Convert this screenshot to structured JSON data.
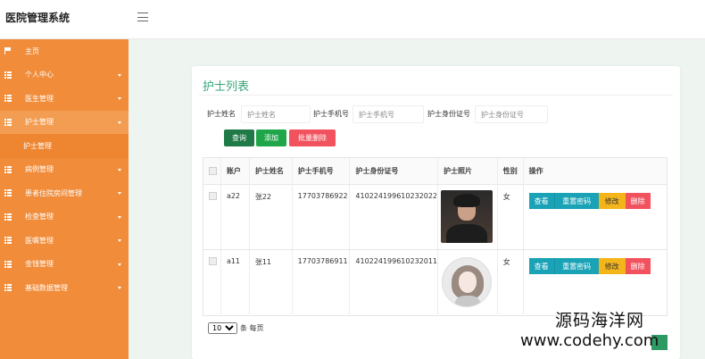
{
  "header": {
    "brand": "医院管理系统"
  },
  "sidebar": {
    "items": [
      {
        "label": "主页",
        "icon": "flag-icon",
        "caret": false
      },
      {
        "label": "个人中心",
        "icon": "list-icon",
        "caret": true
      },
      {
        "label": "医生管理",
        "icon": "list-icon",
        "caret": true
      },
      {
        "label": "护士管理",
        "icon": "list-icon",
        "caret": true,
        "active": true
      },
      {
        "label": "护士管理",
        "icon": "",
        "sub": true
      },
      {
        "label": "病例管理",
        "icon": "list-icon",
        "caret": true
      },
      {
        "label": "患者住院房间管理",
        "icon": "list-icon",
        "caret": true
      },
      {
        "label": "检查管理",
        "icon": "list-icon",
        "caret": true
      },
      {
        "label": "医嘱管理",
        "icon": "list-icon",
        "caret": true
      },
      {
        "label": "金钱管理",
        "icon": "list-icon",
        "caret": true
      },
      {
        "label": "基础数据管理",
        "icon": "list-icon",
        "caret": true
      }
    ]
  },
  "main": {
    "title": "护士列表",
    "search": {
      "name_label": "护士姓名",
      "name_placeholder": "护士姓名",
      "phone_label": "护士手机号",
      "phone_placeholder": "护士手机号",
      "idcard_label": "护士身份证号",
      "idcard_placeholder": "护士身份证号"
    },
    "buttons": {
      "query": "查询",
      "add": "添加",
      "bulk_delete": "批量删除"
    },
    "table": {
      "headers": [
        "账户",
        "护士姓名",
        "护士手机号",
        "护士身份证号",
        "护士照片",
        "性别",
        "操作"
      ],
      "rows": [
        {
          "account": "a22",
          "name": "张22",
          "phone": "17703786922",
          "idcard": "410224199610232022",
          "photo": "male-portrait",
          "sex": "女"
        },
        {
          "account": "a11",
          "name": "张11",
          "phone": "17703786911",
          "idcard": "410224199610232011",
          "photo": "female-illustration",
          "sex": "女"
        }
      ],
      "actions": {
        "view": "查看",
        "reset": "重置密码",
        "edit": "修改",
        "delete": "删除"
      }
    },
    "pager": {
      "page_size": "10",
      "per_page_text": "条 每页"
    }
  },
  "watermark": {
    "line1": "源码海洋网",
    "line2": "www.codehy.com"
  },
  "colors": {
    "sidebar": "#f08c3a",
    "title": "#3aa57a",
    "query": "#1f7a47",
    "add": "#1fa64a",
    "danger": "#f1525e",
    "info": "#1aa3b7",
    "warning": "#f3b51a"
  }
}
